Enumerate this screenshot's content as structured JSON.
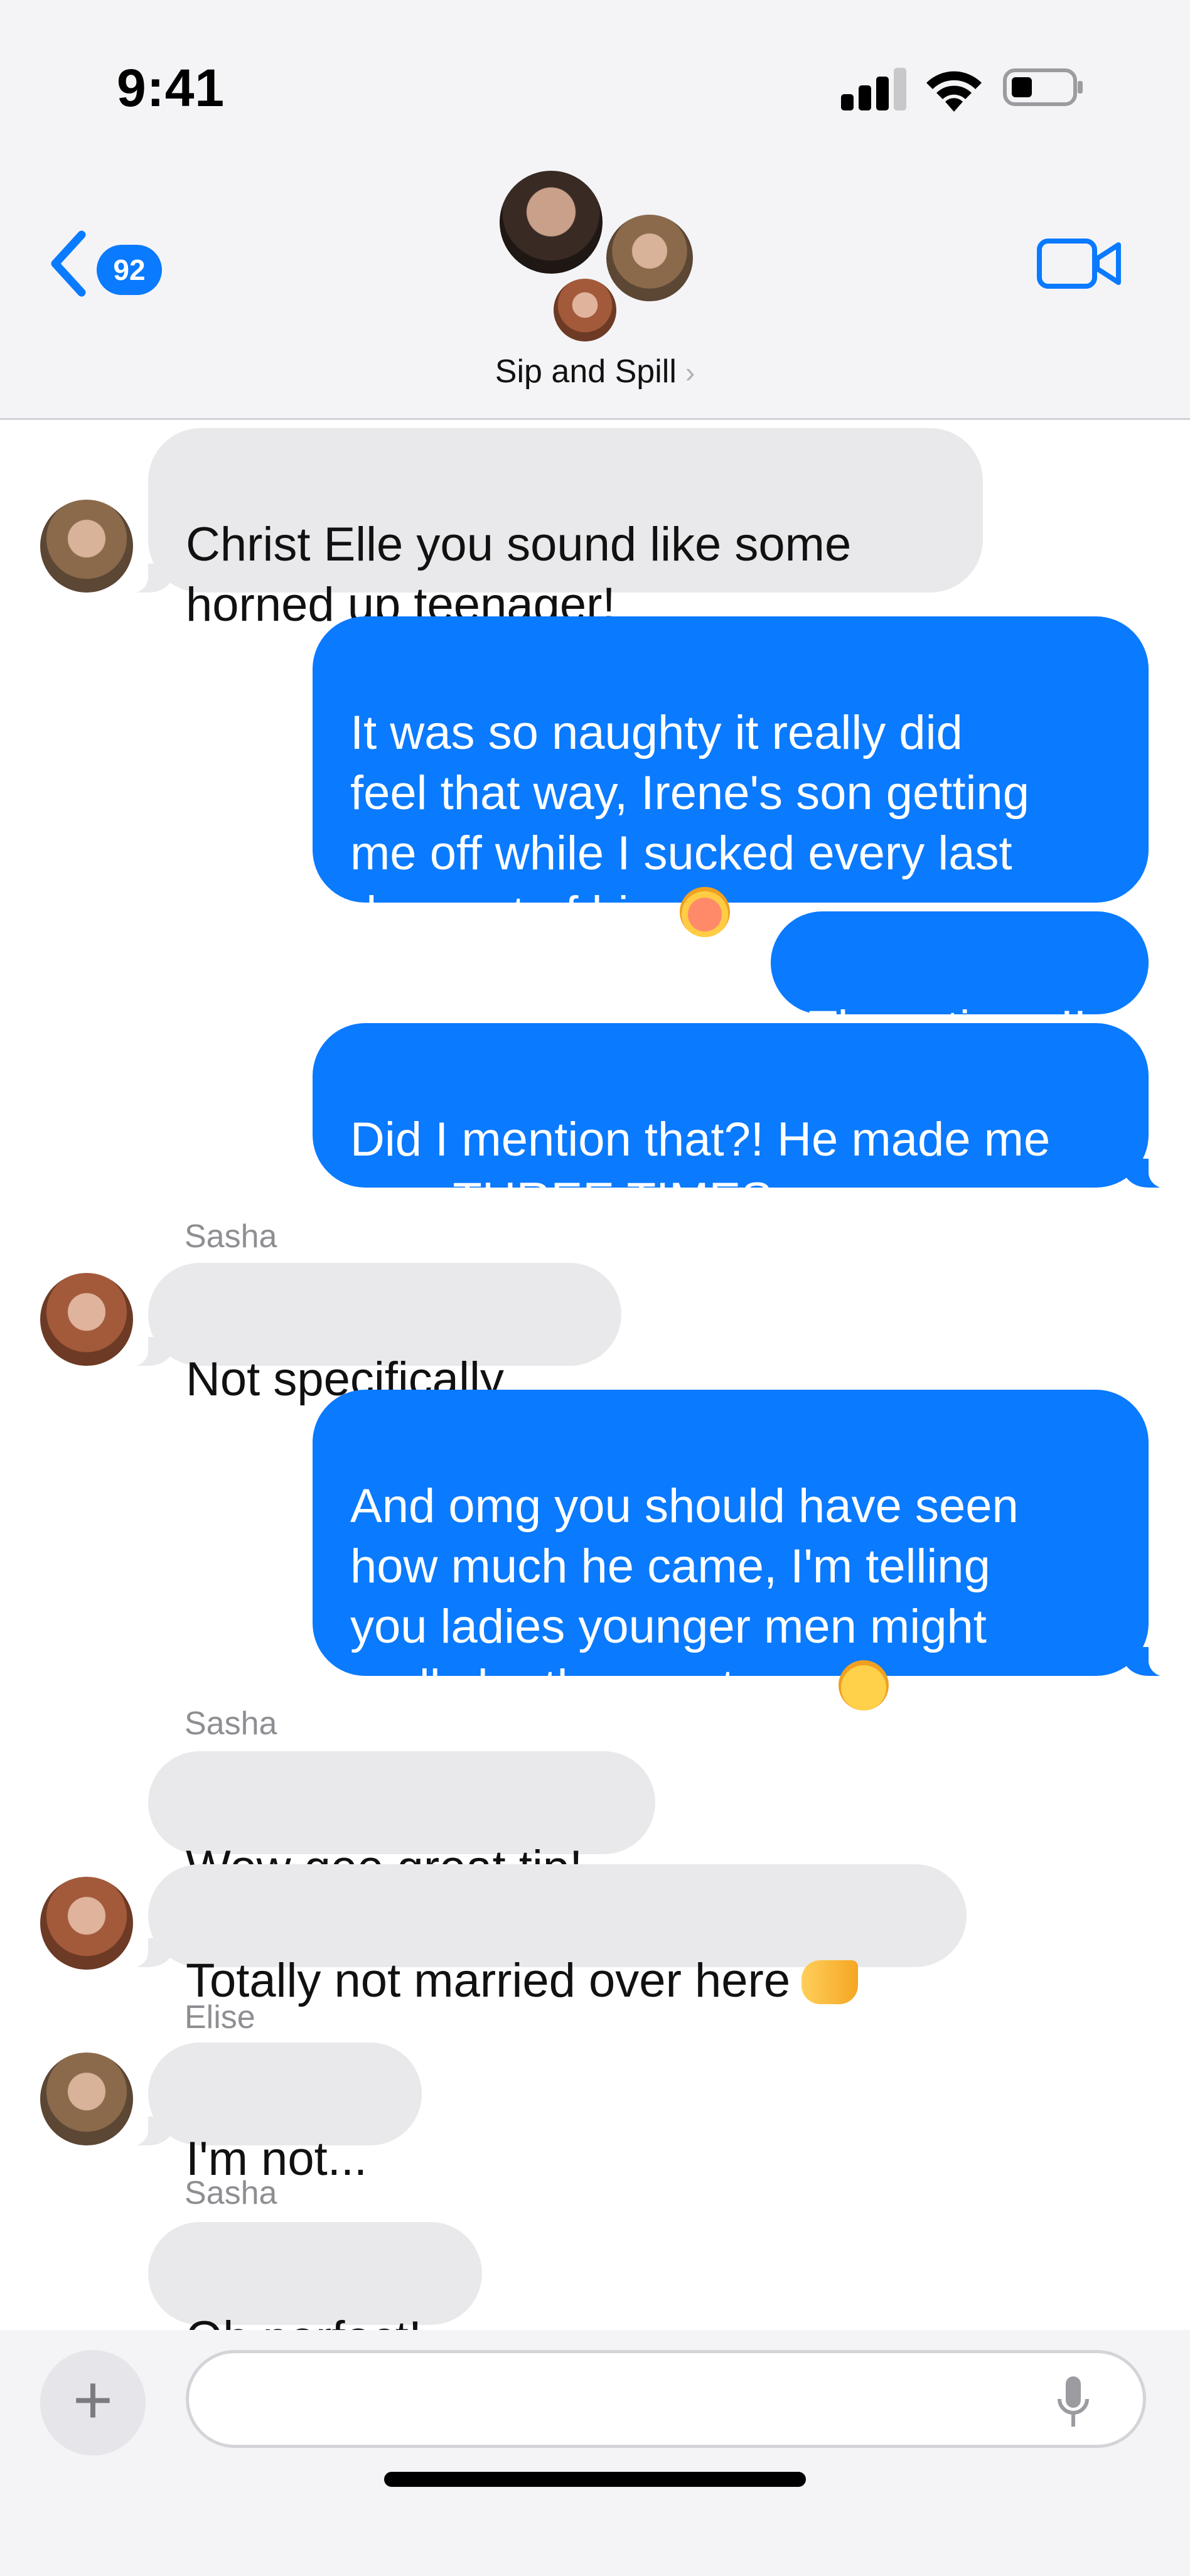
{
  "status_bar": {
    "time": "9:41"
  },
  "header": {
    "back_badge": "92",
    "group_name": "Sip and Spill",
    "group_name_chevron": "›"
  },
  "messages": [
    {
      "direction": "in",
      "text": "Christ Elle you sound like some\nhorned up teenager!"
    },
    {
      "direction": "out",
      "text": "It was so naughty it really did\nfeel that way, Irene's son getting\nme off while I sucked every last\ndrop out of him",
      "emoji": "flushed-face-icon"
    },
    {
      "direction": "out",
      "text": "Three times!!"
    },
    {
      "direction": "out",
      "text": "Did I mention that?! He made me\ncum THREE TIMES"
    },
    {
      "direction": "in",
      "sender": "Sasha",
      "text": "Not specifically..."
    },
    {
      "direction": "out",
      "text": "And omg you should have seen\nhow much he came, I'm telling\nyou ladies younger men might\nreally be the way to go",
      "emoji": "thinking-face-icon"
    },
    {
      "direction": "in",
      "sender": "Sasha",
      "text": "Wow gee great tip!"
    },
    {
      "direction": "in",
      "text": "Totally not married over here",
      "emoji": "pointing-left-icon"
    },
    {
      "direction": "in",
      "sender": "Elise",
      "text": "I'm not..."
    },
    {
      "direction": "in",
      "sender": "Sasha",
      "text": "Oh perfect!"
    }
  ],
  "composer": {
    "placeholder": "",
    "value": ""
  },
  "colors": {
    "accent": "#0a7aff",
    "incoming_bubble": "#e9e9eb",
    "header_bg": "#f4f4f6"
  }
}
